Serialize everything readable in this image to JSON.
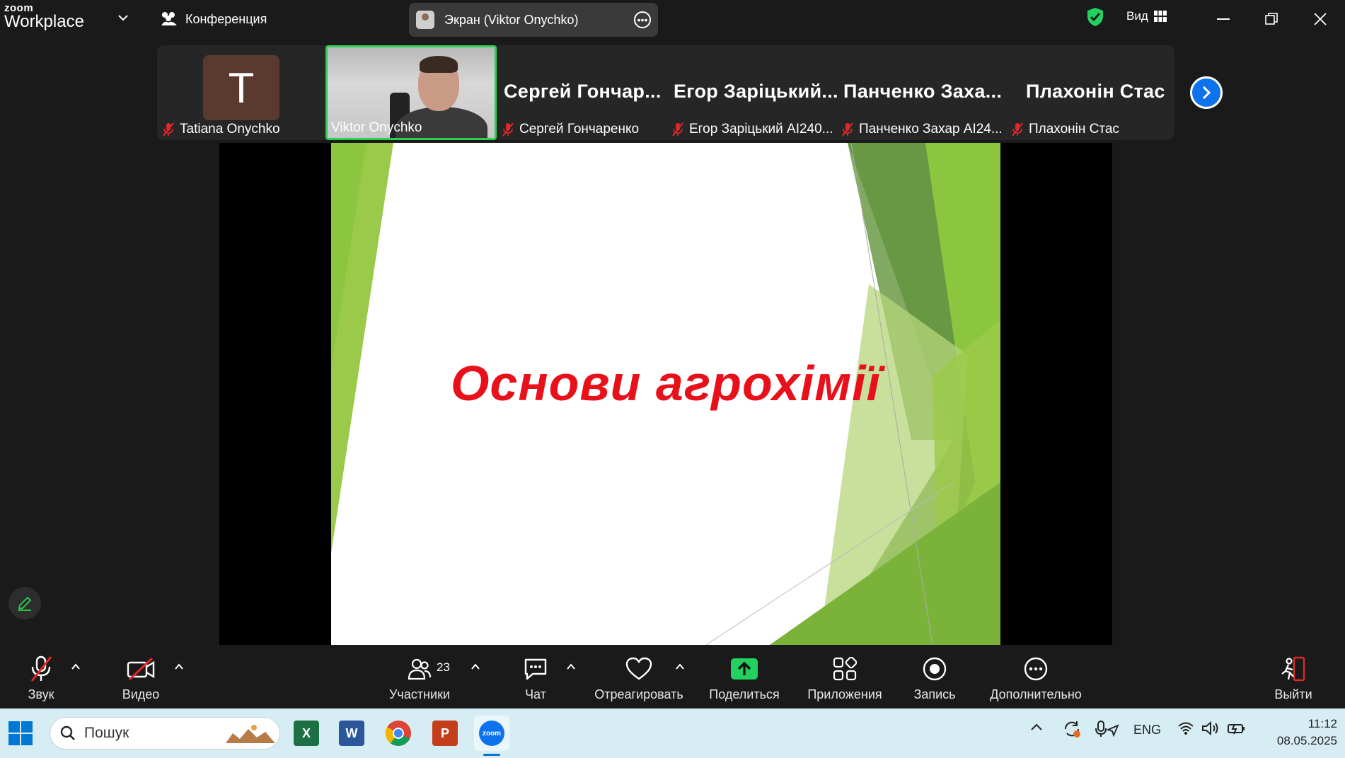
{
  "app": {
    "logo_top": "zoom",
    "logo_bottom": "Workplace",
    "meeting_label": "Конференция"
  },
  "screen_share": {
    "label": "Экран (Viktor Onychko)"
  },
  "view": {
    "label": "Вид"
  },
  "participants": [
    {
      "name": "Tatiana Onychko",
      "initial": "T",
      "big": ""
    },
    {
      "name": "Viktor Onychko",
      "initial": "",
      "big": ""
    },
    {
      "name": "Сергей Гончаренко",
      "initial": "",
      "big": "Сергей  Гончар..."
    },
    {
      "name": "Егор Заріцький АІ240...",
      "initial": "",
      "big": "Егор  Заріцький..."
    },
    {
      "name": "Панченко Захар АІ24...",
      "initial": "",
      "big": "Панченко  Заха..."
    },
    {
      "name": "Плахонін Стас",
      "initial": "",
      "big": "Плахонін Стас"
    }
  ],
  "slide": {
    "title": "Основи агрохімії",
    "title_color": "#e8101a",
    "accent_green": "#8cc63f"
  },
  "toolbar": {
    "audio": "Звук",
    "video": "Видео",
    "participants": "Участники",
    "participants_count": "23",
    "chat": "Чат",
    "react": "Отреагировать",
    "share": "Поделиться",
    "apps": "Приложения",
    "record": "Запись",
    "more": "Дополнительно",
    "leave": "Выйти"
  },
  "taskbar": {
    "search_placeholder": "Пошук",
    "lang": "ENG",
    "time": "11:12",
    "date": "08.05.2025",
    "zoom_app": "zoom"
  }
}
